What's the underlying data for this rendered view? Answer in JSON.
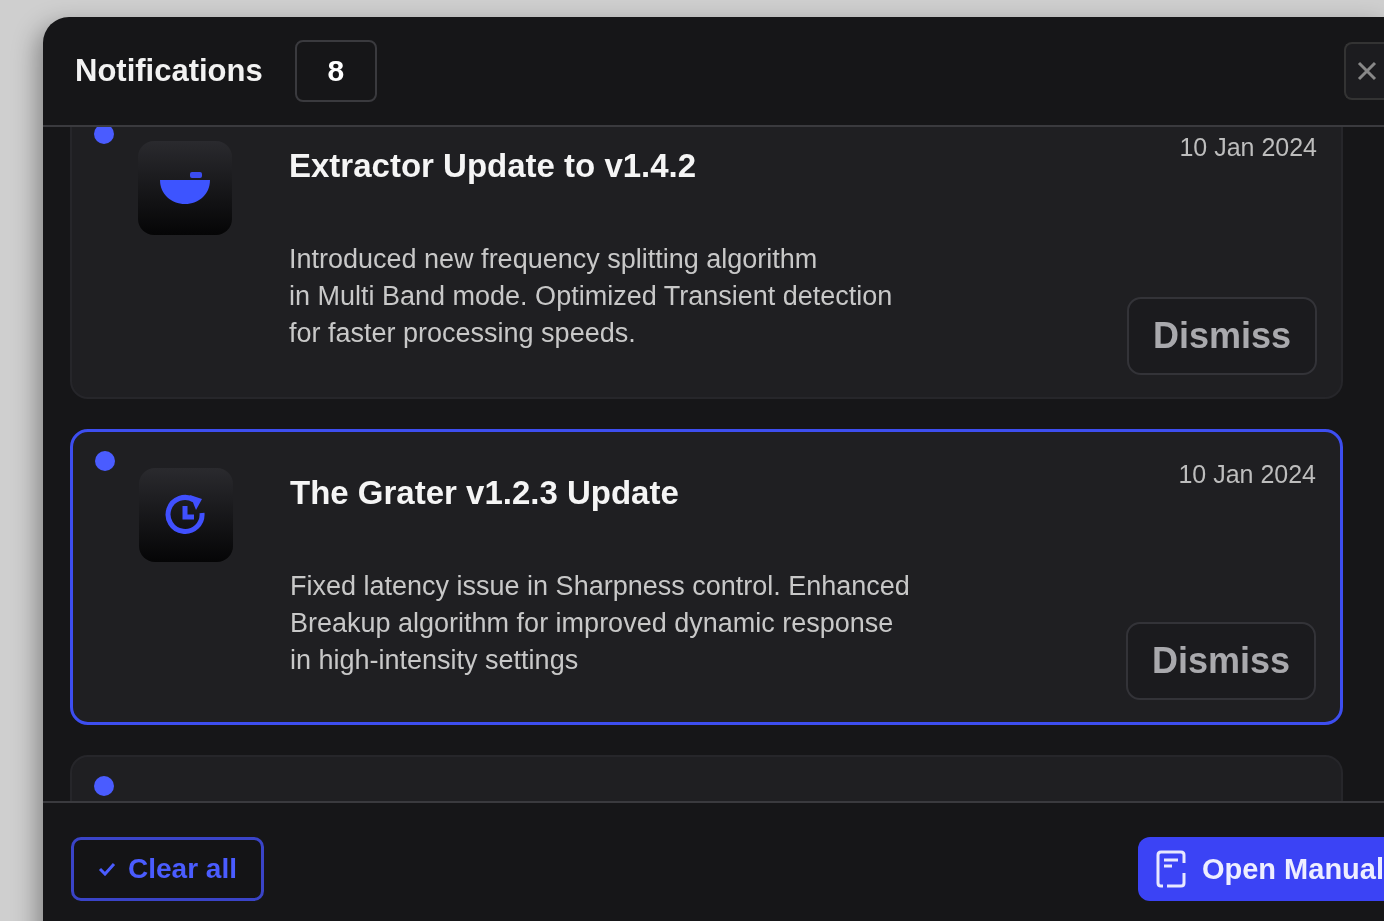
{
  "header": {
    "title": "Notifications",
    "count": "8"
  },
  "notifications": [
    {
      "kind": "bowl",
      "title": "Extractor Update to v1.4.2",
      "date": "10 Jan 2024",
      "body_lines": [
        "Introduced new frequency splitting algorithm",
        "in Multi Band mode. Optimized Transient detection",
        "for faster processing speeds."
      ],
      "action": "Dismiss",
      "unread": true,
      "selected": false
    },
    {
      "kind": "clock-refresh",
      "title": "The Grater v1.2.3 Update",
      "date": "10 Jan 2024",
      "body_lines": [
        "Fixed latency issue in Sharpness control. Enhanced",
        "Breakup algorithm for improved dynamic response",
        "in high-intensity settings"
      ],
      "action": "Dismiss",
      "unread": true,
      "selected": true
    },
    {
      "unread": true,
      "selected": false
    }
  ],
  "footer": {
    "clear_label": "Clear all",
    "manual_label": "Open Manual"
  }
}
